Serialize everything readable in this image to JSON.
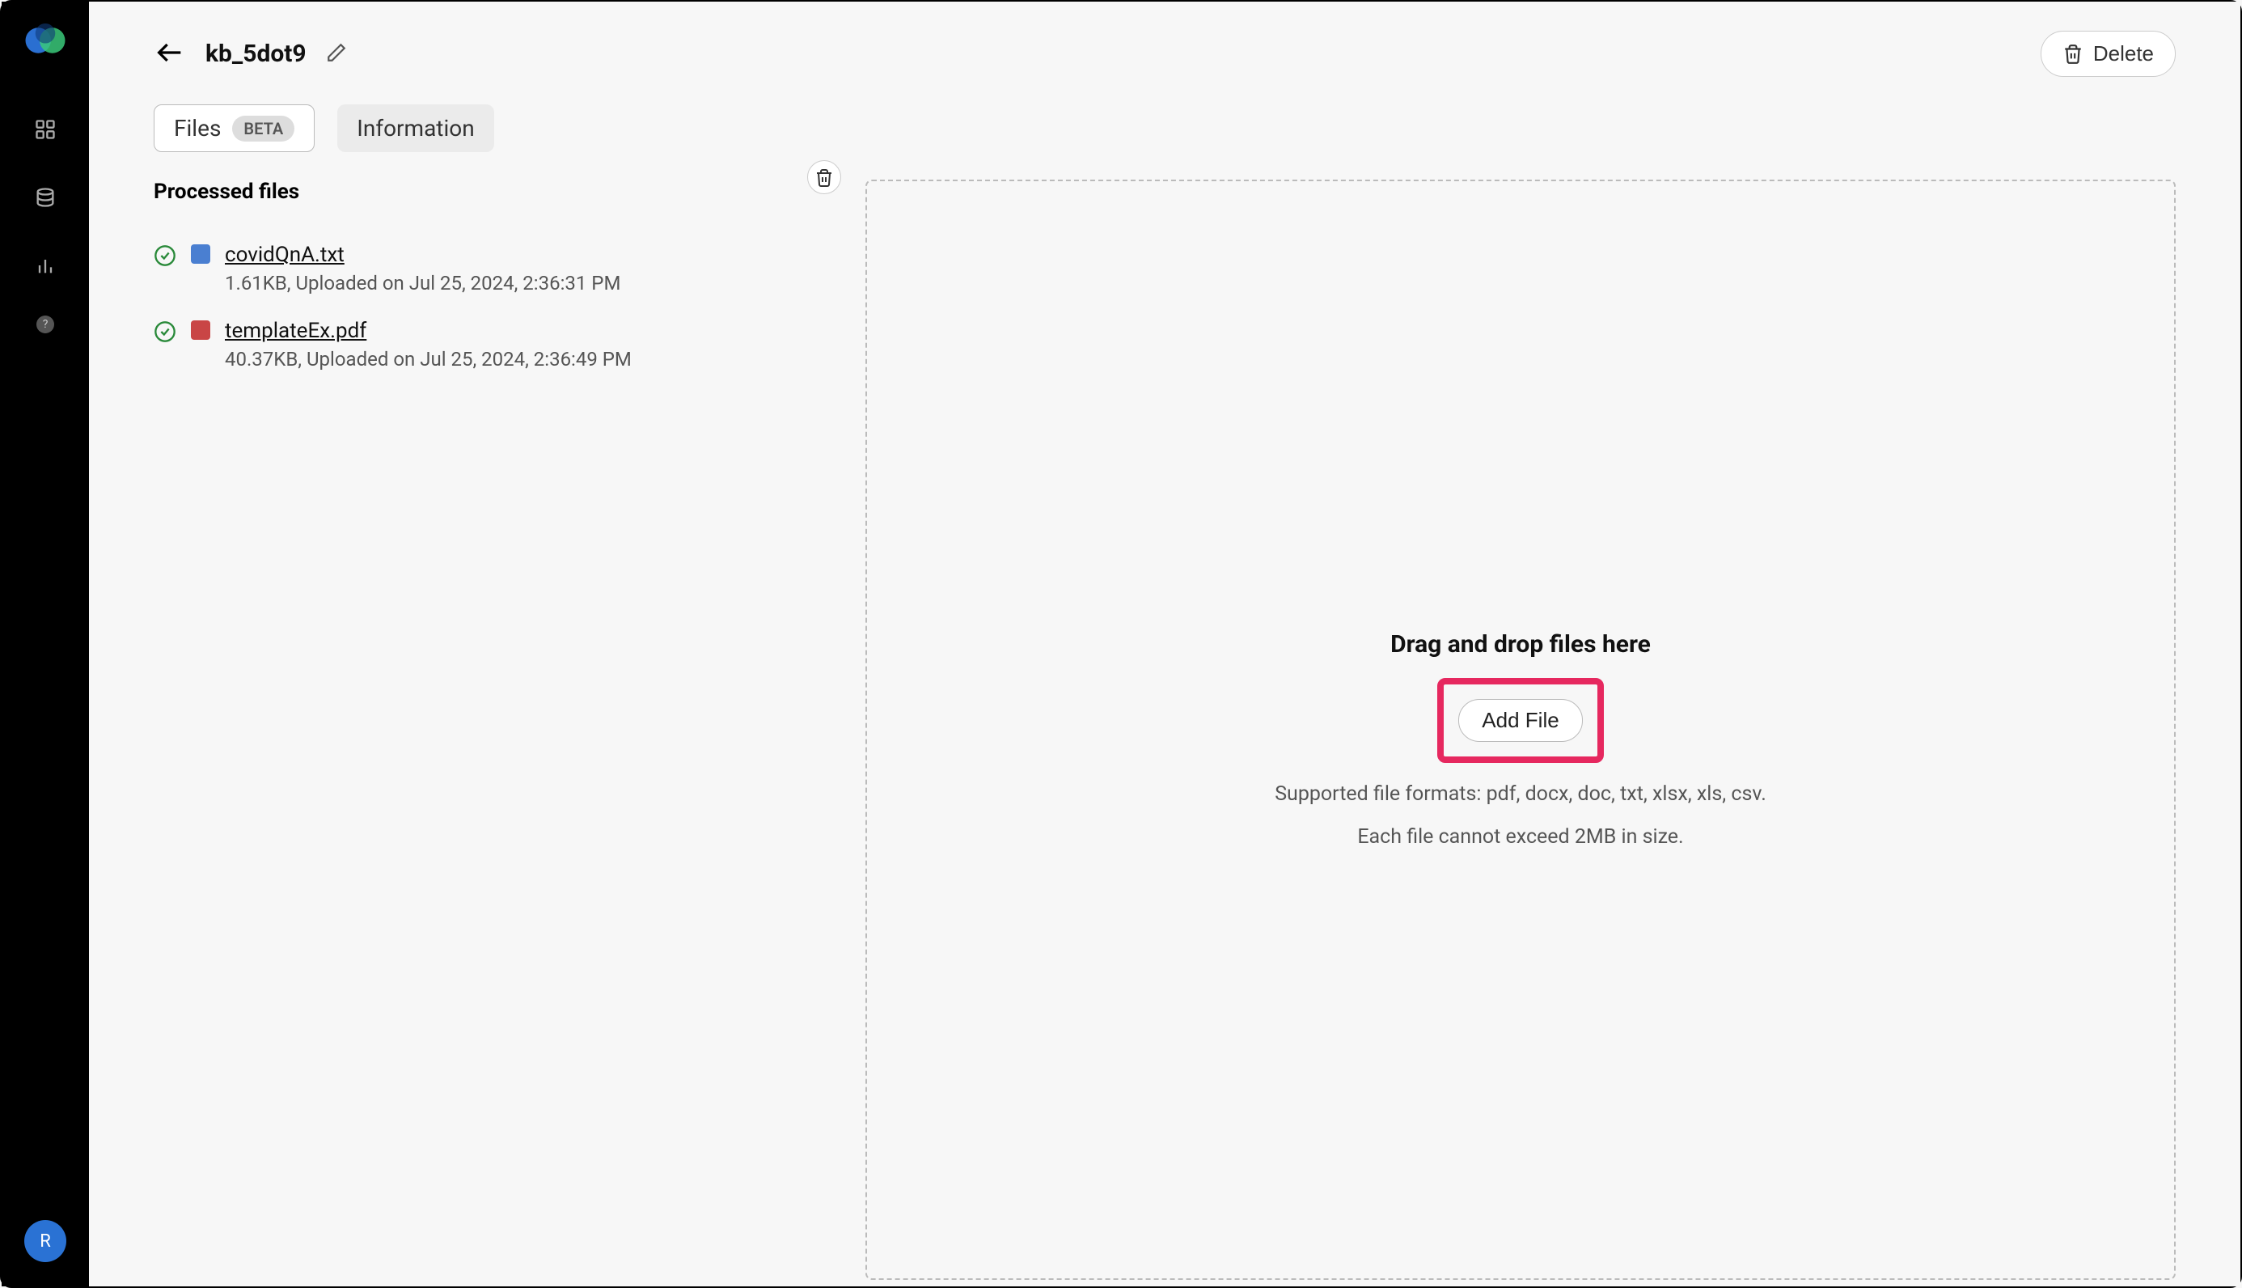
{
  "header": {
    "title": "kb_5dot9",
    "delete_label": "Delete"
  },
  "tabs": {
    "files_label": "Files",
    "beta_badge": "BETA",
    "info_label": "Information"
  },
  "files_section": {
    "title": "Processed files",
    "items": [
      {
        "name": "covidQnA.txt",
        "meta": "1.61KB, Uploaded on Jul 25, 2024, 2:36:31 PM",
        "type": "txt"
      },
      {
        "name": "templateEx.pdf",
        "meta": "40.37KB, Uploaded on Jul 25, 2024, 2:36:49 PM",
        "type": "pdf"
      }
    ]
  },
  "dropzone": {
    "title": "Drag and drop files here",
    "add_label": "Add File",
    "formats": "Supported file formats: pdf, docx, doc, txt, xlsx, xls, csv.",
    "size_limit": "Each file cannot exceed 2MB in size."
  },
  "avatar_initial": "R"
}
